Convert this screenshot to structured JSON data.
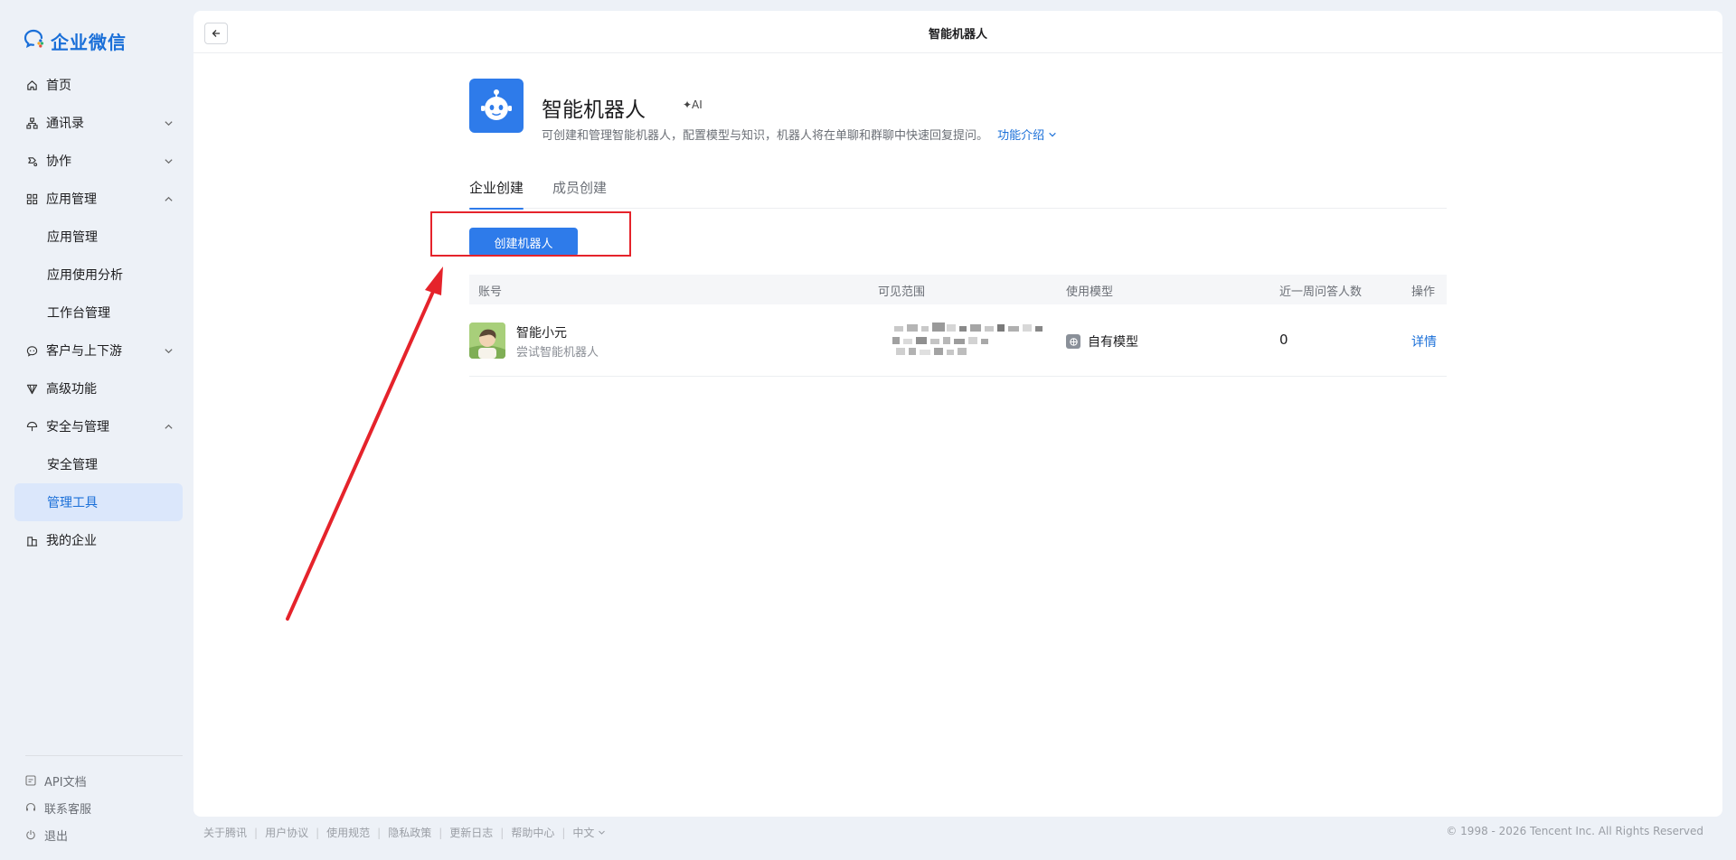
{
  "brand": {
    "name": "企业微信"
  },
  "sidebar": {
    "items": [
      {
        "label": "首页",
        "icon": "home-icon"
      },
      {
        "label": "通讯录",
        "icon": "org-chart-icon",
        "expandable": true,
        "expanded": false
      },
      {
        "label": "协作",
        "icon": "collab-icon",
        "expandable": true,
        "expanded": false
      },
      {
        "label": "应用管理",
        "icon": "grid-icon",
        "expandable": true,
        "expanded": true,
        "children": [
          {
            "label": "应用管理"
          },
          {
            "label": "应用使用分析"
          },
          {
            "label": "工作台管理"
          }
        ]
      },
      {
        "label": "客户与上下游",
        "icon": "chat-bubble-icon",
        "expandable": true,
        "expanded": false
      },
      {
        "label": "高级功能",
        "icon": "diamond-icon"
      },
      {
        "label": "安全与管理",
        "icon": "umbrella-icon",
        "expandable": true,
        "expanded": true,
        "children": [
          {
            "label": "安全管理"
          },
          {
            "label": "管理工具",
            "active": true
          }
        ]
      },
      {
        "label": "我的企业",
        "icon": "building-icon"
      }
    ],
    "bottom": [
      {
        "label": "API文档",
        "icon": "api-doc-icon"
      },
      {
        "label": "联系客服",
        "icon": "headset-icon"
      },
      {
        "label": "退出",
        "icon": "power-icon"
      }
    ]
  },
  "header": {
    "title": "智能机器人"
  },
  "app": {
    "name": "智能机器人",
    "badge": "✦AI",
    "description": "可创建和管理智能机器人，配置模型与知识，机器人将在单聊和群聊中快速回复提问。",
    "intro_link": "功能介绍"
  },
  "tabs": [
    {
      "label": "企业创建",
      "active": true
    },
    {
      "label": "成员创建",
      "active": false
    }
  ],
  "create_button": "创建机器人",
  "table": {
    "columns": [
      "账号",
      "可见范围",
      "使用模型",
      "近一周问答人数",
      "操作"
    ],
    "rows": [
      {
        "name": "智能小元",
        "subtitle": "尝试智能机器人",
        "scope": "",
        "model": "自有模型",
        "count": "0",
        "action": "详情"
      }
    ]
  },
  "footer": {
    "links": [
      "关于腾讯",
      "用户协议",
      "使用规范",
      "隐私政策",
      "更新日志",
      "帮助中心",
      "中文"
    ],
    "copyright": "© 1998 - 2026 Tencent Inc. All Rights Reserved"
  },
  "colors": {
    "accent": "#2e7bea",
    "highlight": "#e5232b",
    "active_bg": "#dbe7fb"
  }
}
